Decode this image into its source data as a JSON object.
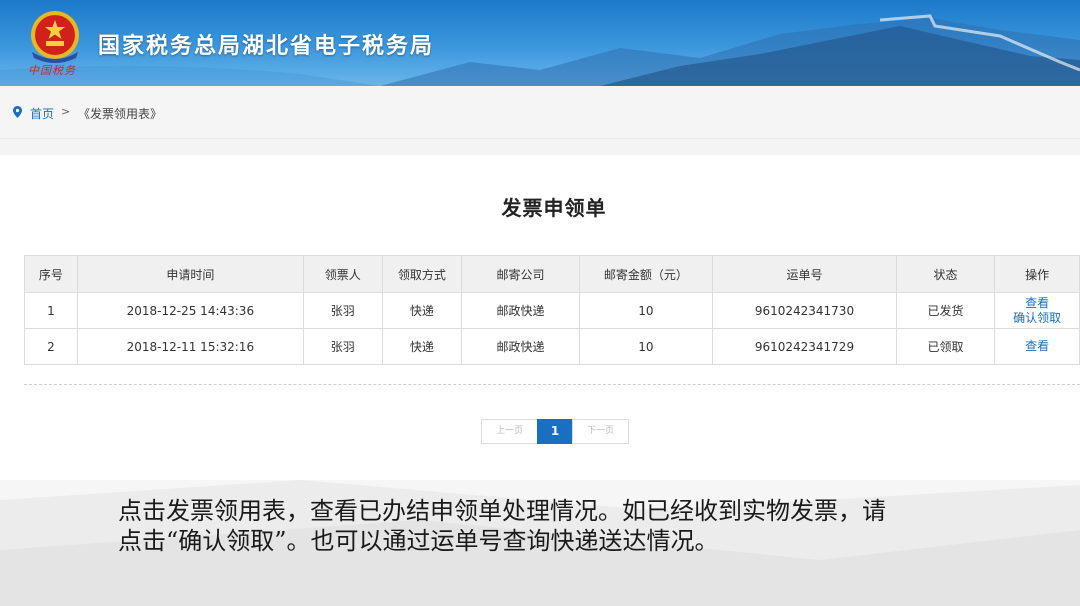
{
  "header": {
    "site_title": "国家税务总局湖北省电子税务局",
    "brand_script": "中国税务"
  },
  "breadcrumb": {
    "home": "首页",
    "separator": ">",
    "current": "《发票领用表》"
  },
  "main": {
    "page_title": "发票申领单",
    "table": {
      "headers": [
        "序号",
        "申请时间",
        "领票人",
        "领取方式",
        "邮寄公司",
        "邮寄金额（元）",
        "运单号",
        "状态",
        "操作"
      ],
      "rows": [
        {
          "index": "1",
          "time": "2018-12-25 14:43:36",
          "recipient": "张羽",
          "method": "快递",
          "company": "邮政快递",
          "amount": "10",
          "waybill": "9610242341730",
          "status": "已发货",
          "actions": [
            "查看",
            "确认领取"
          ]
        },
        {
          "index": "2",
          "time": "2018-12-11 15:32:16",
          "recipient": "张羽",
          "method": "快递",
          "company": "邮政快递",
          "amount": "10",
          "waybill": "9610242341729",
          "status": "已领取",
          "actions": [
            "查看"
          ]
        }
      ]
    },
    "pagination": {
      "prev": "上一页",
      "current": "1",
      "next": "下一页"
    }
  },
  "caption": {
    "line1": "点击发票领用表，查看已办结申领单处理情况。如已经收到实物发票，请",
    "line2": "点击“确认领取”。也可以通过运单号查询快递送达情况。"
  },
  "colors": {
    "header_blue": "#1b79c9",
    "link_blue": "#1a6fc0",
    "emblem_red": "#d0211c",
    "emblem_gold": "#e8b820"
  }
}
